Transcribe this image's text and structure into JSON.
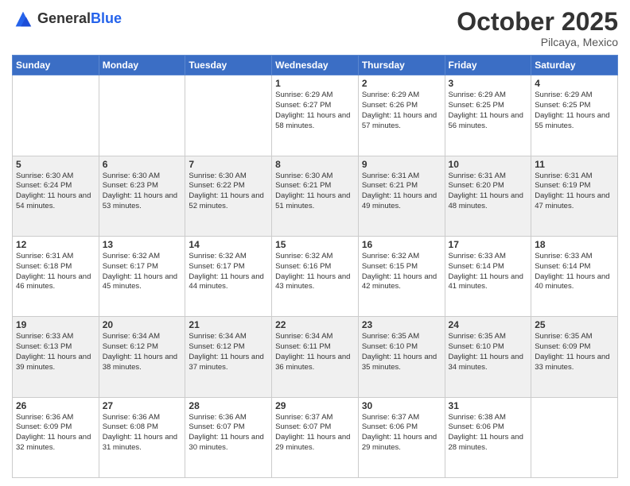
{
  "header": {
    "logo_general": "General",
    "logo_blue": "Blue",
    "month": "October 2025",
    "location": "Pilcaya, Mexico"
  },
  "days": [
    "Sunday",
    "Monday",
    "Tuesday",
    "Wednesday",
    "Thursday",
    "Friday",
    "Saturday"
  ],
  "weeks": [
    [
      {
        "num": "",
        "sunrise": "",
        "sunset": "",
        "daylight": ""
      },
      {
        "num": "",
        "sunrise": "",
        "sunset": "",
        "daylight": ""
      },
      {
        "num": "",
        "sunrise": "",
        "sunset": "",
        "daylight": ""
      },
      {
        "num": "1",
        "sunrise": "Sunrise: 6:29 AM",
        "sunset": "Sunset: 6:27 PM",
        "daylight": "Daylight: 11 hours and 58 minutes."
      },
      {
        "num": "2",
        "sunrise": "Sunrise: 6:29 AM",
        "sunset": "Sunset: 6:26 PM",
        "daylight": "Daylight: 11 hours and 57 minutes."
      },
      {
        "num": "3",
        "sunrise": "Sunrise: 6:29 AM",
        "sunset": "Sunset: 6:25 PM",
        "daylight": "Daylight: 11 hours and 56 minutes."
      },
      {
        "num": "4",
        "sunrise": "Sunrise: 6:29 AM",
        "sunset": "Sunset: 6:25 PM",
        "daylight": "Daylight: 11 hours and 55 minutes."
      }
    ],
    [
      {
        "num": "5",
        "sunrise": "Sunrise: 6:30 AM",
        "sunset": "Sunset: 6:24 PM",
        "daylight": "Daylight: 11 hours and 54 minutes."
      },
      {
        "num": "6",
        "sunrise": "Sunrise: 6:30 AM",
        "sunset": "Sunset: 6:23 PM",
        "daylight": "Daylight: 11 hours and 53 minutes."
      },
      {
        "num": "7",
        "sunrise": "Sunrise: 6:30 AM",
        "sunset": "Sunset: 6:22 PM",
        "daylight": "Daylight: 11 hours and 52 minutes."
      },
      {
        "num": "8",
        "sunrise": "Sunrise: 6:30 AM",
        "sunset": "Sunset: 6:21 PM",
        "daylight": "Daylight: 11 hours and 51 minutes."
      },
      {
        "num": "9",
        "sunrise": "Sunrise: 6:31 AM",
        "sunset": "Sunset: 6:21 PM",
        "daylight": "Daylight: 11 hours and 49 minutes."
      },
      {
        "num": "10",
        "sunrise": "Sunrise: 6:31 AM",
        "sunset": "Sunset: 6:20 PM",
        "daylight": "Daylight: 11 hours and 48 minutes."
      },
      {
        "num": "11",
        "sunrise": "Sunrise: 6:31 AM",
        "sunset": "Sunset: 6:19 PM",
        "daylight": "Daylight: 11 hours and 47 minutes."
      }
    ],
    [
      {
        "num": "12",
        "sunrise": "Sunrise: 6:31 AM",
        "sunset": "Sunset: 6:18 PM",
        "daylight": "Daylight: 11 hours and 46 minutes."
      },
      {
        "num": "13",
        "sunrise": "Sunrise: 6:32 AM",
        "sunset": "Sunset: 6:17 PM",
        "daylight": "Daylight: 11 hours and 45 minutes."
      },
      {
        "num": "14",
        "sunrise": "Sunrise: 6:32 AM",
        "sunset": "Sunset: 6:17 PM",
        "daylight": "Daylight: 11 hours and 44 minutes."
      },
      {
        "num": "15",
        "sunrise": "Sunrise: 6:32 AM",
        "sunset": "Sunset: 6:16 PM",
        "daylight": "Daylight: 11 hours and 43 minutes."
      },
      {
        "num": "16",
        "sunrise": "Sunrise: 6:32 AM",
        "sunset": "Sunset: 6:15 PM",
        "daylight": "Daylight: 11 hours and 42 minutes."
      },
      {
        "num": "17",
        "sunrise": "Sunrise: 6:33 AM",
        "sunset": "Sunset: 6:14 PM",
        "daylight": "Daylight: 11 hours and 41 minutes."
      },
      {
        "num": "18",
        "sunrise": "Sunrise: 6:33 AM",
        "sunset": "Sunset: 6:14 PM",
        "daylight": "Daylight: 11 hours and 40 minutes."
      }
    ],
    [
      {
        "num": "19",
        "sunrise": "Sunrise: 6:33 AM",
        "sunset": "Sunset: 6:13 PM",
        "daylight": "Daylight: 11 hours and 39 minutes."
      },
      {
        "num": "20",
        "sunrise": "Sunrise: 6:34 AM",
        "sunset": "Sunset: 6:12 PM",
        "daylight": "Daylight: 11 hours and 38 minutes."
      },
      {
        "num": "21",
        "sunrise": "Sunrise: 6:34 AM",
        "sunset": "Sunset: 6:12 PM",
        "daylight": "Daylight: 11 hours and 37 minutes."
      },
      {
        "num": "22",
        "sunrise": "Sunrise: 6:34 AM",
        "sunset": "Sunset: 6:11 PM",
        "daylight": "Daylight: 11 hours and 36 minutes."
      },
      {
        "num": "23",
        "sunrise": "Sunrise: 6:35 AM",
        "sunset": "Sunset: 6:10 PM",
        "daylight": "Daylight: 11 hours and 35 minutes."
      },
      {
        "num": "24",
        "sunrise": "Sunrise: 6:35 AM",
        "sunset": "Sunset: 6:10 PM",
        "daylight": "Daylight: 11 hours and 34 minutes."
      },
      {
        "num": "25",
        "sunrise": "Sunrise: 6:35 AM",
        "sunset": "Sunset: 6:09 PM",
        "daylight": "Daylight: 11 hours and 33 minutes."
      }
    ],
    [
      {
        "num": "26",
        "sunrise": "Sunrise: 6:36 AM",
        "sunset": "Sunset: 6:09 PM",
        "daylight": "Daylight: 11 hours and 32 minutes."
      },
      {
        "num": "27",
        "sunrise": "Sunrise: 6:36 AM",
        "sunset": "Sunset: 6:08 PM",
        "daylight": "Daylight: 11 hours and 31 minutes."
      },
      {
        "num": "28",
        "sunrise": "Sunrise: 6:36 AM",
        "sunset": "Sunset: 6:07 PM",
        "daylight": "Daylight: 11 hours and 30 minutes."
      },
      {
        "num": "29",
        "sunrise": "Sunrise: 6:37 AM",
        "sunset": "Sunset: 6:07 PM",
        "daylight": "Daylight: 11 hours and 29 minutes."
      },
      {
        "num": "30",
        "sunrise": "Sunrise: 6:37 AM",
        "sunset": "Sunset: 6:06 PM",
        "daylight": "Daylight: 11 hours and 29 minutes."
      },
      {
        "num": "31",
        "sunrise": "Sunrise: 6:38 AM",
        "sunset": "Sunset: 6:06 PM",
        "daylight": "Daylight: 11 hours and 28 minutes."
      },
      {
        "num": "",
        "sunrise": "",
        "sunset": "",
        "daylight": ""
      }
    ]
  ]
}
